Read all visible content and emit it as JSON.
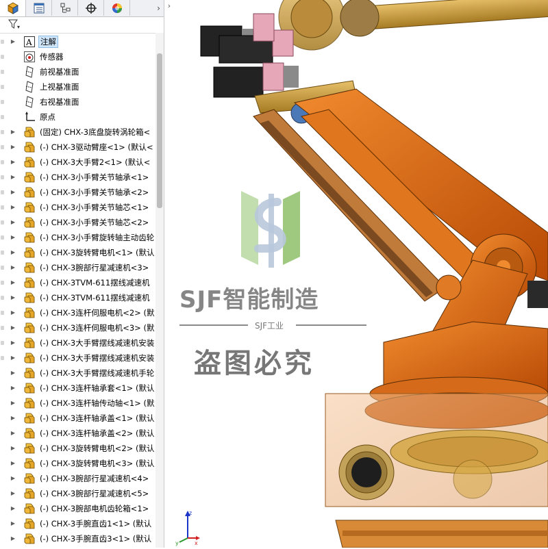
{
  "tabs": [
    {
      "name": "feature-manager",
      "icon": "part-cube-icon"
    },
    {
      "name": "property-manager",
      "icon": "property-list-icon"
    },
    {
      "name": "configuration-manager",
      "icon": "configuration-icon"
    },
    {
      "name": "dimxpert-manager",
      "icon": "crosshair-icon"
    },
    {
      "name": "display-manager",
      "icon": "appearance-sphere-icon"
    }
  ],
  "tab_more": "›",
  "filter": {
    "icon": "filter-icon",
    "dropdown": "▾"
  },
  "tree": [
    {
      "label": "注解",
      "icon": "annotation-icon",
      "arrow": "▶",
      "selected": true
    },
    {
      "label": "传感器",
      "icon": "sensor-icon",
      "arrow": ""
    },
    {
      "label": "前视基准面",
      "icon": "plane-icon",
      "arrow": ""
    },
    {
      "label": "上视基准面",
      "icon": "plane-icon",
      "arrow": ""
    },
    {
      "label": "右视基准面",
      "icon": "plane-icon",
      "arrow": ""
    },
    {
      "label": "原点",
      "icon": "origin-icon",
      "arrow": ""
    },
    {
      "label": "(固定) CHX-3底盘旋转涡轮箱<",
      "icon": "part-icon",
      "arrow": "▶"
    },
    {
      "label": "(-) CHX-3驱动臂座<1> (默认<",
      "icon": "part-icon",
      "arrow": "▶"
    },
    {
      "label": "(-) CHX-3大手臂2<1> (默认<",
      "icon": "part-icon",
      "arrow": "▶"
    },
    {
      "label": "(-) CHX-3小手臂关节轴承<1>",
      "icon": "part-icon",
      "arrow": "▶"
    },
    {
      "label": "(-) CHX-3小手臂关节轴承<2>",
      "icon": "part-icon",
      "arrow": "▶"
    },
    {
      "label": "(-) CHX-3小手臂关节轴芯<1>",
      "icon": "part-icon",
      "arrow": "▶"
    },
    {
      "label": "(-) CHX-3小手臂关节轴芯<2>",
      "icon": "part-icon",
      "arrow": "▶"
    },
    {
      "label": "(-) CHX-3小手臂旋转轴主动齿轮",
      "icon": "part-icon",
      "arrow": "▶"
    },
    {
      "label": "(-) CHX-3旋转臂电机<1> (默认",
      "icon": "part-icon",
      "arrow": "▶"
    },
    {
      "label": "(-) CHX-3腕部行星减速机<3>",
      "icon": "part-icon",
      "arrow": "▶"
    },
    {
      "label": "(-) CHX-3TVM-611摆线减速机",
      "icon": "part-icon",
      "arrow": "▶"
    },
    {
      "label": "(-) CHX-3TVM-611摆线减速机",
      "icon": "part-icon",
      "arrow": "▶"
    },
    {
      "label": "(-) CHX-3连杆伺服电机<2> (默",
      "icon": "part-icon",
      "arrow": "▶"
    },
    {
      "label": "(-) CHX-3连杆伺服电机<3> (默",
      "icon": "part-icon",
      "arrow": "▶"
    },
    {
      "label": "(-) CHX-3大手臂摆线减速机安装",
      "icon": "part-icon",
      "arrow": "▶"
    },
    {
      "label": "(-) CHX-3大手臂摆线减速机安装",
      "icon": "part-icon",
      "arrow": "▶"
    },
    {
      "label": "(-) CHX-3大手臂摆线减速机手轮",
      "icon": "part-icon",
      "arrow": "▶"
    },
    {
      "label": "(-) CHX-3连杆轴承套<1> (默认",
      "icon": "part-icon",
      "arrow": "▶"
    },
    {
      "label": "(-) CHX-3连杆轴传动轴<1> (默",
      "icon": "part-icon",
      "arrow": "▶"
    },
    {
      "label": "(-) CHX-3连杆轴承盖<1> (默认",
      "icon": "part-icon",
      "arrow": "▶"
    },
    {
      "label": "(-) CHX-3连杆轴承盖<2> (默认",
      "icon": "part-icon",
      "arrow": "▶"
    },
    {
      "label": "(-) CHX-3旋转臂电机<2> (默认",
      "icon": "part-icon",
      "arrow": "▶"
    },
    {
      "label": "(-) CHX-3旋转臂电机<3> (默认",
      "icon": "part-icon",
      "arrow": "▶"
    },
    {
      "label": "(-) CHX-3腕部行星减速机<4>",
      "icon": "part-icon",
      "arrow": "▶"
    },
    {
      "label": "(-) CHX-3腕部行星减速机<5>",
      "icon": "part-icon",
      "arrow": "▶"
    },
    {
      "label": "(-) CHX-3腕部电机齿轮箱<1>",
      "icon": "part-icon",
      "arrow": "▶"
    },
    {
      "label": "(-) CHX-3手腕直齿1<1> (默认",
      "icon": "part-icon",
      "arrow": "▶"
    },
    {
      "label": "(-) CHX-3手腕直齿3<1> (默认",
      "icon": "part-icon",
      "arrow": "▶"
    }
  ],
  "watermark": {
    "brand": "SJF智能制造",
    "sub": "SJF工业",
    "warning": "盗图必究"
  },
  "viewport": {
    "model_colors": {
      "orange": "#d9600f",
      "gold": "#c8a04a",
      "motor": "#2a2a2a",
      "pink": "#e6a7b8"
    }
  },
  "triad": {
    "x": "x",
    "y": "y",
    "z": "z"
  }
}
